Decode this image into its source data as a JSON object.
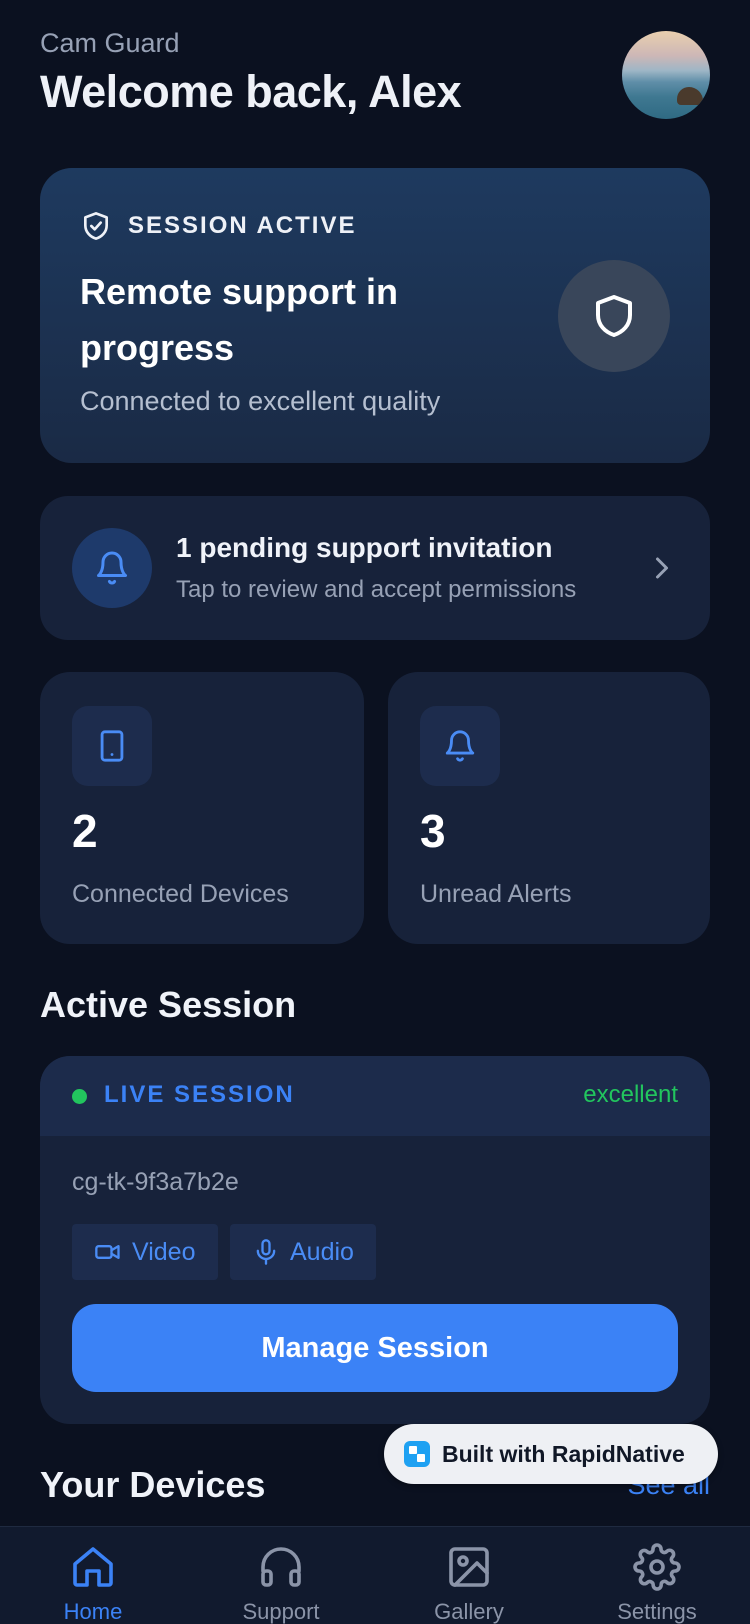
{
  "header": {
    "app_name": "Cam Guard",
    "welcome": "Welcome back, Alex"
  },
  "session_card": {
    "badge": "SESSION ACTIVE",
    "title": "Remote support in progress",
    "subtitle": "Connected to excellent quality",
    "icon": "shield-icon"
  },
  "invitation": {
    "title": "1 pending support invitation",
    "subtitle": "Tap to review and accept permissions",
    "icon": "bell-icon"
  },
  "stats": [
    {
      "value": "2",
      "label": "Connected Devices",
      "icon": "tablet-icon"
    },
    {
      "value": "3",
      "label": "Unread Alerts",
      "icon": "bell-icon"
    }
  ],
  "active_session": {
    "section_title": "Active Session",
    "live_label": "LIVE SESSION",
    "quality": "excellent",
    "session_id": "cg-tk-9f3a7b2e",
    "chips": [
      {
        "label": "Video",
        "icon": "video-icon"
      },
      {
        "label": "Audio",
        "icon": "mic-icon"
      }
    ],
    "manage_button": "Manage Session"
  },
  "devices": {
    "section_title": "Your Devices",
    "see_all": "See all"
  },
  "badge_overlay": {
    "text": "Built with RapidNative"
  },
  "nav": [
    {
      "label": "Home",
      "icon": "home-icon",
      "active": true
    },
    {
      "label": "Support",
      "icon": "headset-icon",
      "active": false
    },
    {
      "label": "Gallery",
      "icon": "image-icon",
      "active": false
    },
    {
      "label": "Settings",
      "icon": "gear-icon",
      "active": false
    }
  ],
  "colors": {
    "background": "#0b1120",
    "card": "#17223a",
    "accent": "#3b82f6",
    "live": "#22c55e"
  }
}
